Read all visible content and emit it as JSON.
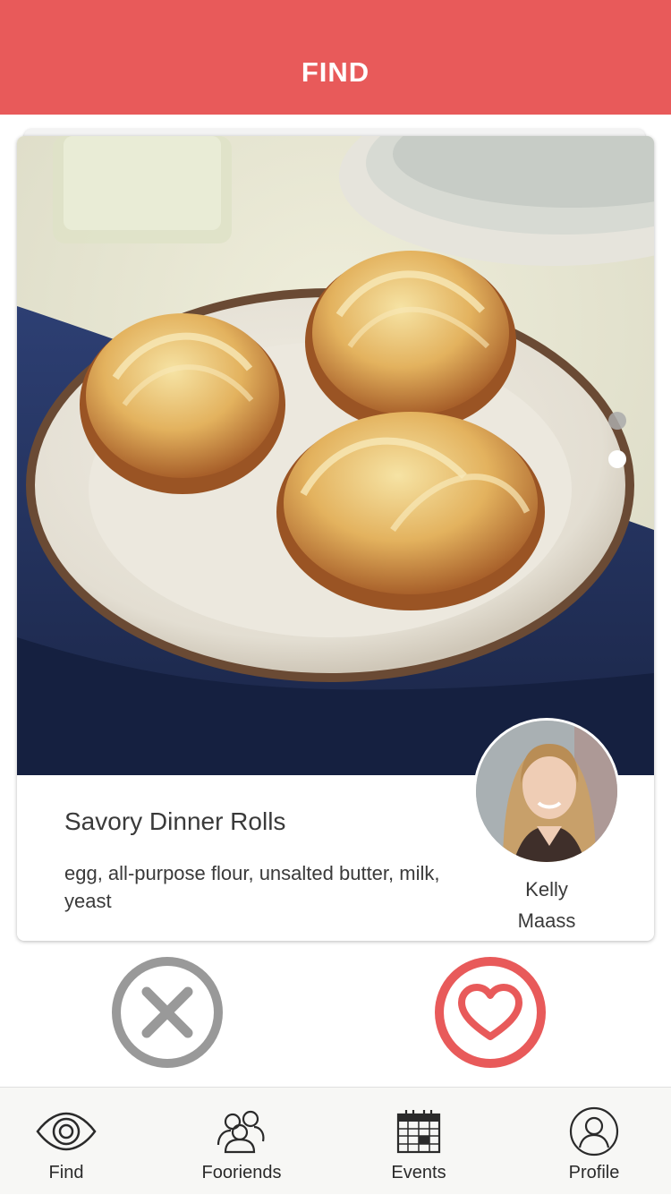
{
  "header": {
    "title": "FIND"
  },
  "card": {
    "recipe_title": "Savory Dinner Rolls",
    "ingredients": "egg, all-purpose flour, unsalted butter, milk, yeast",
    "author": {
      "first_name": "Kelly",
      "last_name": "Maass"
    },
    "photo_pages": 2,
    "current_page": 2
  },
  "actions": {
    "dismiss_icon": "close-x-icon",
    "like_icon": "heart-icon"
  },
  "tabs": [
    {
      "label": "Find",
      "icon": "eye-icon"
    },
    {
      "label": "Fooriends",
      "icon": "people-icon"
    },
    {
      "label": "Events",
      "icon": "calendar-icon"
    },
    {
      "label": "Profile",
      "icon": "user-icon"
    }
  ],
  "colors": {
    "brand": "#e85a5a",
    "dismiss_gray": "#999999"
  }
}
